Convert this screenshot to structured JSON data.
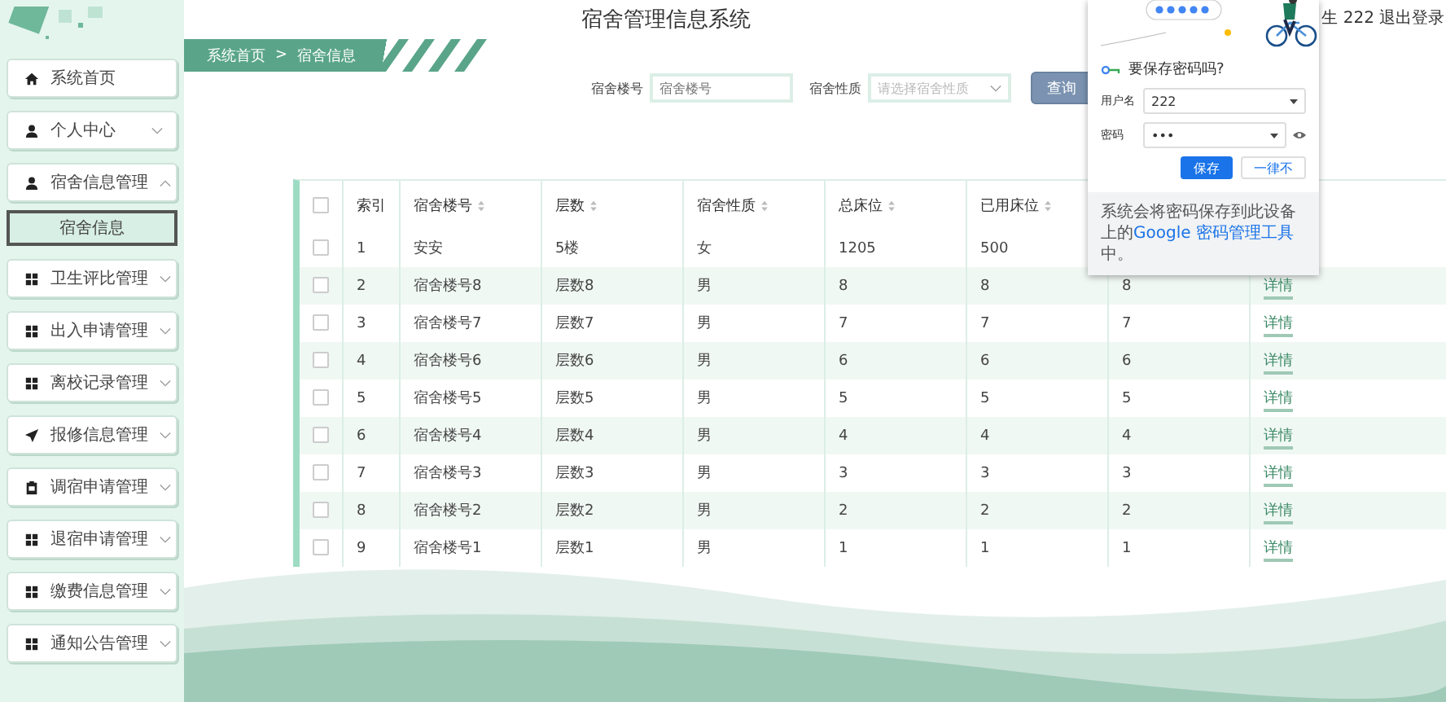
{
  "sidebar": {
    "items": [
      {
        "kind": "home",
        "label": "系统首页"
      },
      {
        "kind": "user",
        "label": "个人中心",
        "expanded": false
      },
      {
        "kind": "user",
        "label": "宿舍信息管理",
        "expanded": true,
        "children": [
          {
            "label": "宿舍信息",
            "selected": true
          }
        ]
      },
      {
        "kind": "grid",
        "label": "卫生评比管理",
        "expanded": false
      },
      {
        "kind": "grid",
        "label": "出入申请管理",
        "expanded": false
      },
      {
        "kind": "grid",
        "label": "离校记录管理",
        "expanded": false
      },
      {
        "kind": "send",
        "label": "报修信息管理",
        "expanded": false
      },
      {
        "kind": "clipboard",
        "label": "调宿申请管理",
        "expanded": false
      },
      {
        "kind": "grid",
        "label": "退宿申请管理",
        "expanded": false
      },
      {
        "kind": "grid",
        "label": "缴费信息管理",
        "expanded": false
      },
      {
        "kind": "grid",
        "label": "通知公告管理",
        "expanded": false
      }
    ]
  },
  "header": {
    "title": "宿舍管理信息系统",
    "user": "生 222",
    "logout": "退出登录"
  },
  "breadcrumb": {
    "home": "系统首页",
    "separator": ">",
    "current": "宿舍信息"
  },
  "search": {
    "fields": [
      {
        "kind": "input",
        "label": "宿舍楼号",
        "placeholder": "宿舍楼号"
      },
      {
        "kind": "select",
        "label": "宿舍性质",
        "placeholder": "请选择宿舍性质"
      }
    ],
    "button": "查询"
  },
  "table": {
    "header_checked": false,
    "columns": [
      "索引",
      "宿舍楼号",
      "层数",
      "宿舍性质",
      "总床位",
      "已用床位"
    ],
    "rows": [
      {
        "checked": false,
        "cells": [
          "1",
          "安安",
          "5楼",
          "女",
          "1205",
          "500"
        ]
      },
      {
        "checked": false,
        "cells": [
          "2",
          "宿舍楼号8",
          "层数8",
          "男",
          "8",
          "8"
        ],
        "column_8": "8",
        "action": "详情"
      },
      {
        "checked": false,
        "cells": [
          "3",
          "宿舍楼号7",
          "层数7",
          "男",
          "7",
          "7"
        ],
        "column_8": "7",
        "action": "详情"
      },
      {
        "checked": false,
        "cells": [
          "4",
          "宿舍楼号6",
          "层数6",
          "男",
          "6",
          "6"
        ],
        "column_8": "6",
        "action": "详情"
      },
      {
        "checked": false,
        "cells": [
          "5",
          "宿舍楼号5",
          "层数5",
          "男",
          "5",
          "5"
        ],
        "column_8": "5",
        "action": "详情"
      },
      {
        "checked": false,
        "cells": [
          "6",
          "宿舍楼号4",
          "层数4",
          "男",
          "4",
          "4"
        ],
        "column_8": "4",
        "action": "详情"
      },
      {
        "checked": false,
        "cells": [
          "7",
          "宿舍楼号3",
          "层数3",
          "男",
          "3",
          "3"
        ],
        "column_8": "3",
        "action": "详情"
      },
      {
        "checked": false,
        "cells": [
          "8",
          "宿舍楼号2",
          "层数2",
          "男",
          "2",
          "2"
        ],
        "column_8": "2",
        "action": "详情"
      },
      {
        "checked": false,
        "cells": [
          "9",
          "宿舍楼号1",
          "层数1",
          "男",
          "1",
          "1"
        ],
        "column_8": "1",
        "action": "详情"
      }
    ]
  },
  "password_popup": {
    "title": "要保存密码吗?",
    "fields": [
      {
        "label": "用户名",
        "value": "222"
      },
      {
        "label": "密码",
        "value": "•••",
        "kind": "password"
      }
    ],
    "save": "保存",
    "never": "一律不",
    "note": "系统会将密码保存到此设备上的",
    "link": "Google 密码管理工具",
    "note_end": "中。"
  }
}
